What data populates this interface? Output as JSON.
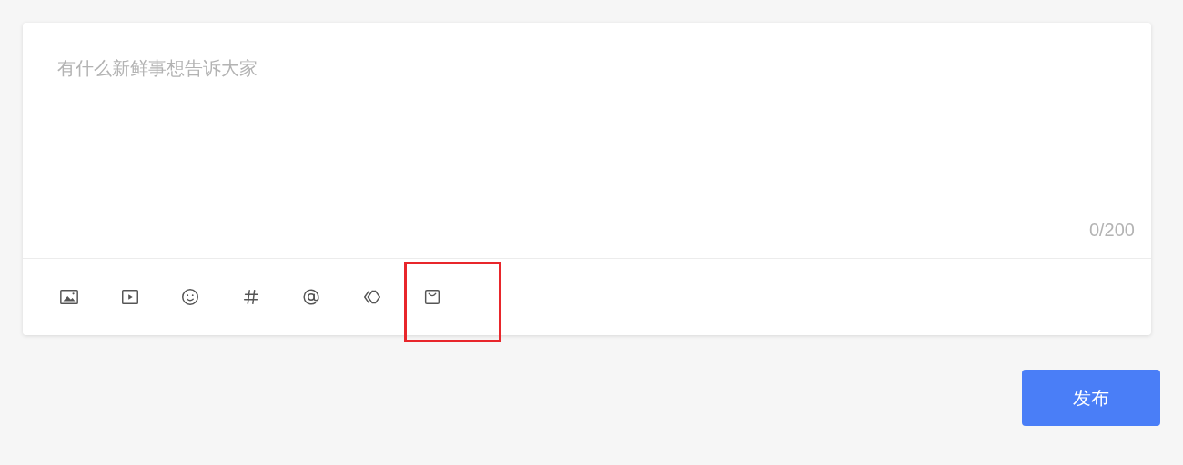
{
  "editor": {
    "placeholder": "有什么新鲜事想告诉大家",
    "counter": "0/200"
  },
  "tools": [
    {
      "kind": "image",
      "highlighted": false
    },
    {
      "kind": "video",
      "highlighted": false
    },
    {
      "kind": "emoji",
      "highlighted": false
    },
    {
      "kind": "topic",
      "highlighted": false
    },
    {
      "kind": "mention",
      "highlighted": false
    },
    {
      "kind": "link",
      "highlighted": false
    },
    {
      "kind": "bag",
      "highlighted": true
    }
  ],
  "publish_button": "发布"
}
